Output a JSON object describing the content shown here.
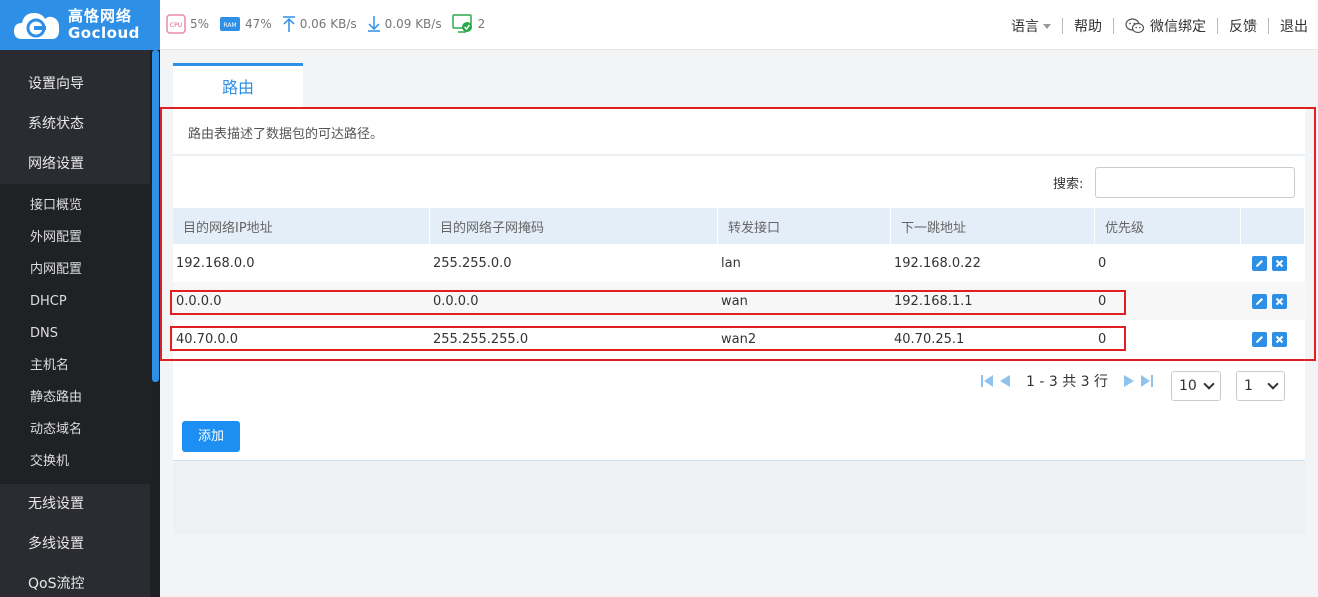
{
  "brand": {
    "name_cn": "高恪网络",
    "name_en": "Gocloud"
  },
  "status": {
    "cpu_label": "CPU",
    "cpu": "5%",
    "ram_label": "RAM",
    "ram": "47%",
    "upload": "0.06 KB/s",
    "download": "0.09 KB/s",
    "clients": "2"
  },
  "nav": {
    "language": "语言",
    "help": "帮助",
    "wechat": "微信绑定",
    "feedback": "反馈",
    "logout": "退出"
  },
  "sidebar": {
    "top_items": [
      "设置向导",
      "系统状态",
      "网络设置"
    ],
    "sub_items": [
      "接口概览",
      "外网配置",
      "内网配置",
      "DHCP",
      "DNS",
      "主机名",
      "静态路由",
      "动态域名",
      "交换机"
    ],
    "bottom_items": [
      "无线设置",
      "多线设置",
      "QoS流控"
    ]
  },
  "tab": {
    "label": "路由"
  },
  "panel": {
    "description": "路由表描述了数据包的可达路径。",
    "search_label": "搜索:",
    "search_value": ""
  },
  "table": {
    "headers": [
      "目的网络IP地址",
      "目的网络子网掩码",
      "转发接口",
      "下一跳地址",
      "优先级"
    ],
    "rows": [
      [
        "192.168.0.0",
        "255.255.0.0",
        "lan",
        "192.168.0.22",
        "0"
      ],
      [
        "0.0.0.0",
        "0.0.0.0",
        "wan",
        "192.168.1.1",
        "0"
      ],
      [
        "40.70.0.0",
        "255.255.255.0",
        "wan2",
        "40.70.25.1",
        "0"
      ]
    ]
  },
  "pagination": {
    "summary": "1 - 3 共 3 行",
    "page_size": "10",
    "page": "1"
  },
  "add_button": "添加",
  "colors": {
    "accent": "#2e8fe6",
    "sidebar_bg": "#2a2c31",
    "highlight": "#e02020"
  }
}
